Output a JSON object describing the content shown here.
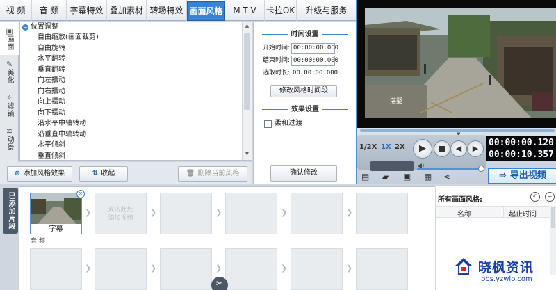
{
  "tabs": [
    "视 频",
    "音 频",
    "字幕特效",
    "叠加素材",
    "转场特效",
    "画面风格",
    "M T V",
    "卡拉OK",
    "升级与服务"
  ],
  "active_tab_index": 5,
  "side_tabs": [
    {
      "label": "画面",
      "icon": "picture-icon"
    },
    {
      "label": "美化",
      "icon": "wand-icon"
    },
    {
      "label": "滤镜",
      "icon": "filter-icon"
    },
    {
      "label": "动景",
      "icon": "wave-icon"
    }
  ],
  "tree": {
    "group_label": "位置调整",
    "items": [
      "自由缩放(画面裁剪)",
      "自由旋转",
      "水平翻转",
      "垂直翻转",
      "向左摆动",
      "向右摆动",
      "向上摆动",
      "向下摆动",
      "沿水平中轴转动",
      "沿垂直中轴转动",
      "水平倾斜",
      "垂直倾斜"
    ]
  },
  "list_tools": {
    "add": "添加风格效果",
    "collapse": "收起",
    "delete": "删除当前风格"
  },
  "time_settings": {
    "title": "时间设置",
    "start_label": "开始时间:",
    "start_value": "00:00:00.000",
    "end_label": "结束时间:",
    "end_value": "00:00:00.000",
    "duration_label": "选取时长:",
    "duration_value": "00:00:00.000",
    "modify_button": "修改风格时间段"
  },
  "effect_settings": {
    "title": "效果设置",
    "soft_transition": "柔和过渡",
    "confirm_button": "确认修改"
  },
  "preview": {
    "caption": "湛婴"
  },
  "playback": {
    "speeds": [
      "1/2X",
      "1X",
      "2X"
    ],
    "active_speed_index": 1,
    "current_time": "00:00:00.120",
    "total_time": "00:00:10.357",
    "volume": 0.95,
    "export_label": "导出视频"
  },
  "sidebar_label": "已添加片段",
  "timeline": {
    "clip_label": "字幕",
    "placeholder_text": "双击此处\n添加视频",
    "audio_label": "音 频"
  },
  "styles_panel": {
    "title": "所有画面风格:",
    "col_name": "名称",
    "col_time": "起止时间"
  },
  "watermark": {
    "name": "晓枫资讯",
    "url": "bbs.yzwlo.com"
  },
  "colors": {
    "accent": "#3a82d4",
    "brand_watermark": "#1a3fa8"
  }
}
